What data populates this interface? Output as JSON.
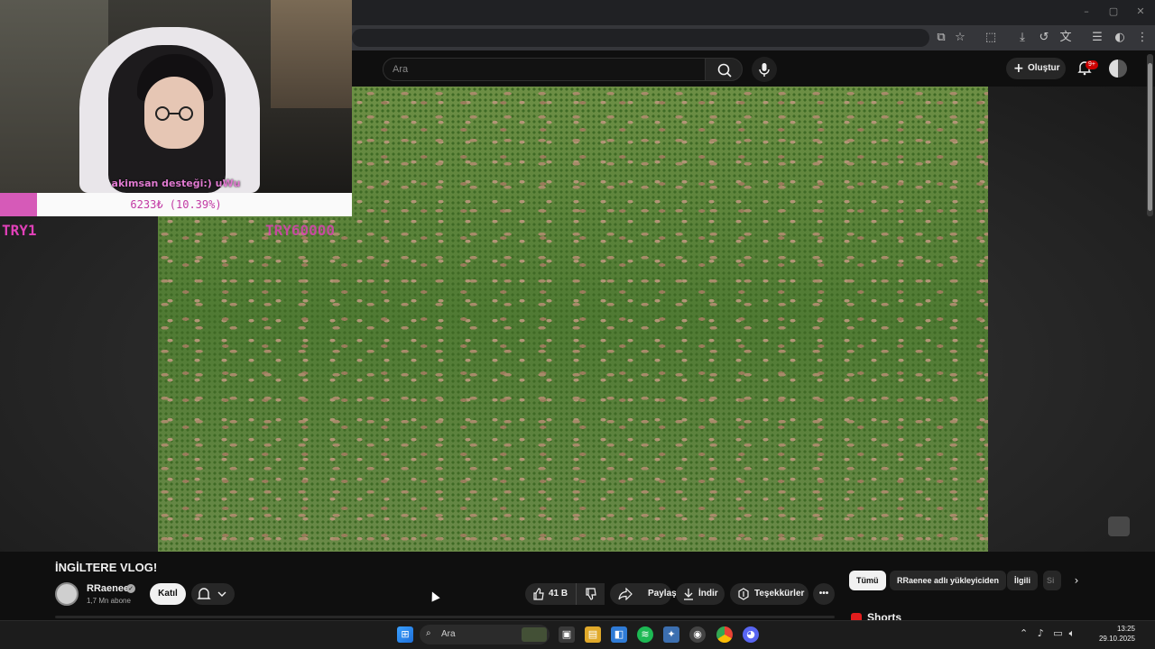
{
  "browser": {
    "window_controls": [
      "–",
      "▢",
      "✕"
    ],
    "toolbar_icons": [
      "install-app-icon",
      "star-icon",
      "extensions-icon",
      "download-icon",
      "history-icon",
      "translate-icon",
      "reading-mode-icon",
      "profile-icon",
      "kebab-menu-icon"
    ]
  },
  "youtube": {
    "search_placeholder": "Ara",
    "create_label": "Oluştur",
    "notifications_badge": "9+"
  },
  "overlay": {
    "caption": "akimsan desteği:) uWu",
    "goal_text": "6233₺ (10.39%)",
    "goal_fraction": 0.1039,
    "goal_left": "TRY1",
    "goal_right": "TRY60000"
  },
  "video": {
    "title": "İNGİLTERE VLOG!",
    "channel_name": "RRaenee",
    "subscribers": "1,7 Mn abone",
    "join_label": "Katıl",
    "likes": "41 B",
    "share_label": "Paylaş",
    "download_label": "İndir",
    "thanks_label": "Teşekkürler",
    "more_label": "•••"
  },
  "chips": {
    "all": "Tümü",
    "uploader": "RRaenee adlı yükleyiciden",
    "related": "İlgili",
    "more": "Si"
  },
  "shorts": {
    "label": "Shorts"
  },
  "taskbar": {
    "search_label": "Ara",
    "time": "13:25",
    "date": "29.10.2025"
  },
  "colors": {
    "accent_pink": "#d65ab8",
    "youtube_red": "#cc0000",
    "background": "#0f0f0f"
  }
}
